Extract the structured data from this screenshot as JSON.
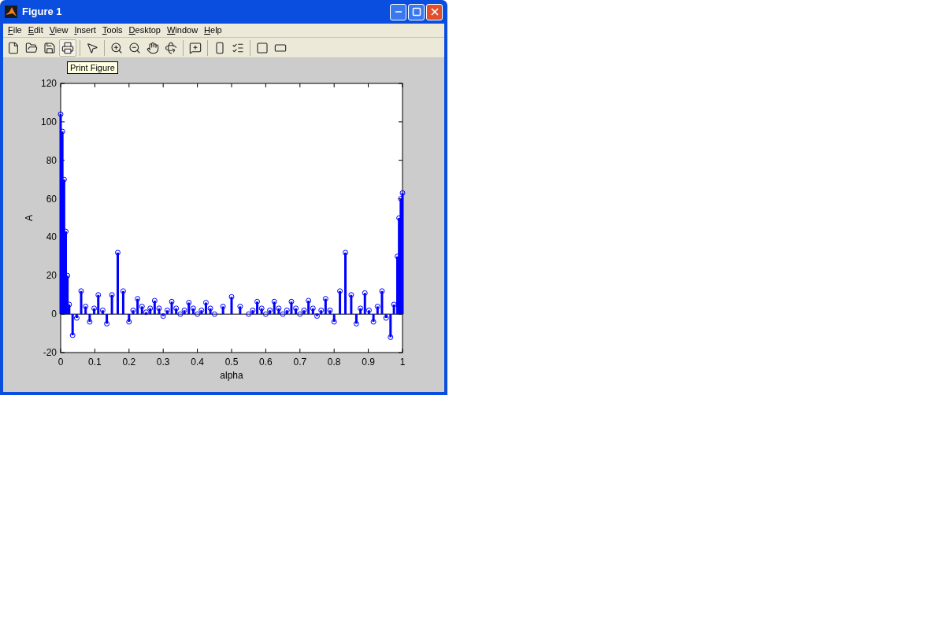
{
  "window": {
    "title": "Figure 1"
  },
  "menu": [
    "File",
    "Edit",
    "View",
    "Insert",
    "Tools",
    "Desktop",
    "Window",
    "Help"
  ],
  "toolbar": [
    {
      "kind": "new"
    },
    {
      "kind": "open"
    },
    {
      "kind": "save"
    },
    {
      "kind": "print",
      "selected": true
    },
    {
      "kind": "sep"
    },
    {
      "kind": "pointer"
    },
    {
      "kind": "sep"
    },
    {
      "kind": "zoom-in"
    },
    {
      "kind": "zoom-out"
    },
    {
      "kind": "pan"
    },
    {
      "kind": "rotate"
    },
    {
      "kind": "sep"
    },
    {
      "kind": "data-cursor"
    },
    {
      "kind": "sep"
    },
    {
      "kind": "colorbar"
    },
    {
      "kind": "legend"
    },
    {
      "kind": "sep"
    },
    {
      "kind": "hide-tools"
    },
    {
      "kind": "show-tools"
    }
  ],
  "tooltip": "Print Figure",
  "figure": {
    "chart_data": {
      "type": "scatter",
      "xlabel": "alpha",
      "ylabel": "A",
      "xlim": [
        0,
        1
      ],
      "ylim": [
        -20,
        120
      ],
      "xticks": [
        {
          "value": 0,
          "label": "0"
        },
        {
          "value": 0.1,
          "label": "0.1"
        },
        {
          "value": 0.2,
          "label": "0.2"
        },
        {
          "value": 0.3,
          "label": "0.3"
        },
        {
          "value": 0.4,
          "label": "0.4"
        },
        {
          "value": 0.5,
          "label": "0.5"
        },
        {
          "value": 0.6,
          "label": "0.6"
        },
        {
          "value": 0.7,
          "label": "0.7"
        },
        {
          "value": 0.8,
          "label": "0.8"
        },
        {
          "value": 0.9,
          "label": "0.9"
        },
        {
          "value": 1,
          "label": "1"
        }
      ],
      "yticks": [
        {
          "value": -20,
          "label": "-20"
        },
        {
          "value": 0,
          "label": "0"
        },
        {
          "value": 20,
          "label": "20"
        },
        {
          "value": 40,
          "label": "40"
        },
        {
          "value": 60,
          "label": "60"
        },
        {
          "value": 80,
          "label": "80"
        },
        {
          "value": 100,
          "label": "100"
        },
        {
          "value": 120,
          "label": "120"
        }
      ],
      "x": [
        0,
        0.005,
        0.01,
        0.015,
        0.02,
        0.025,
        0.035,
        0.047,
        0.06,
        0.073,
        0.085,
        0.098,
        0.11,
        0.123,
        0.135,
        0.15,
        0.167,
        0.183,
        0.2,
        0.212,
        0.225,
        0.238,
        0.25,
        0.262,
        0.275,
        0.288,
        0.3,
        0.312,
        0.325,
        0.338,
        0.35,
        0.362,
        0.375,
        0.388,
        0.4,
        0.412,
        0.425,
        0.438,
        0.45,
        0.475,
        0.5,
        0.525,
        0.55,
        0.562,
        0.575,
        0.588,
        0.6,
        0.612,
        0.625,
        0.638,
        0.65,
        0.662,
        0.675,
        0.688,
        0.7,
        0.712,
        0.725,
        0.738,
        0.75,
        0.762,
        0.775,
        0.788,
        0.8,
        0.817,
        0.833,
        0.85,
        0.865,
        0.877,
        0.89,
        0.902,
        0.915,
        0.927,
        0.94,
        0.952,
        0.965,
        0.975,
        0.985,
        0.99,
        0.995,
        1
      ],
      "series": [
        {
          "color": "#0000ff",
          "values": [
            104,
            95,
            70,
            43,
            20,
            5,
            -11,
            -2,
            12,
            4,
            -4,
            3,
            10,
            2,
            -5,
            10,
            32,
            12,
            -4,
            2,
            8,
            4,
            1,
            3,
            7,
            3,
            -1,
            2,
            6.5,
            3,
            0,
            2,
            6,
            3,
            0,
            2,
            6,
            3,
            0,
            4,
            9,
            4,
            0,
            2,
            6.5,
            3,
            0,
            2,
            6.5,
            3,
            0,
            2,
            6.5,
            3,
            0,
            2,
            7,
            3,
            -1,
            2,
            8,
            2,
            -4,
            12,
            32,
            10,
            -5,
            3,
            11,
            2,
            -4,
            4,
            12,
            -2,
            -12,
            5,
            30,
            50,
            60,
            63
          ]
        }
      ]
    }
  }
}
